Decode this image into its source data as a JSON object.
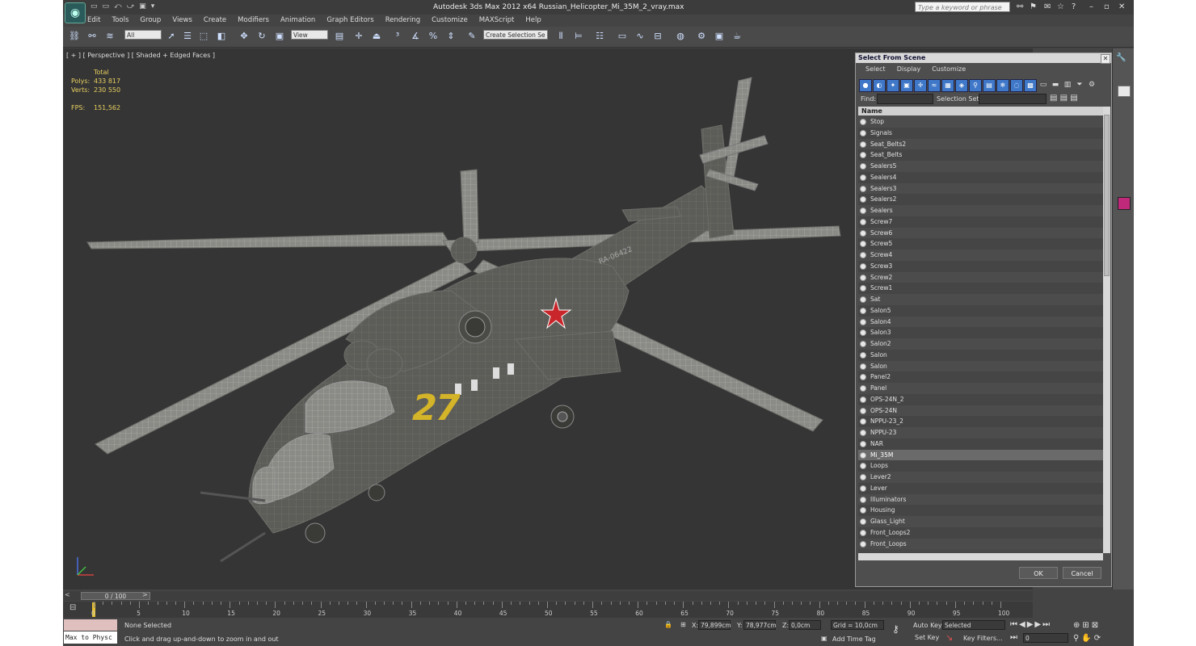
{
  "app": {
    "title": "Autodesk 3ds Max  2012 x64     Russian_Helicopter_Mi_35M_2_vray.max",
    "search_placeholder": "Type a keyword or phrase"
  },
  "menu": [
    "Edit",
    "Tools",
    "Group",
    "Views",
    "Create",
    "Modifiers",
    "Animation",
    "Graph Editors",
    "Rendering",
    "Customize",
    "MAXScript",
    "Help"
  ],
  "toolbar": {
    "selection_filter": "All",
    "reference_coord": "View",
    "named_selection": "Create Selection Se"
  },
  "viewport": {
    "label": "[ + ] [ Perspective ] [ Shaded + Edged Faces ]",
    "stats_header": "Total",
    "stats": [
      {
        "label": "Polys:",
        "value": "433 817"
      },
      {
        "label": "Verts:",
        "value": "230 550"
      }
    ],
    "fps_label": "FPS:",
    "fps_value": "151,562"
  },
  "dialog": {
    "title": "Select From Scene",
    "menu": [
      "Select",
      "Display",
      "Customize"
    ],
    "find_label": "Find:",
    "selection_set_label": "Selection Set:",
    "column_header": "Name",
    "items": [
      "Stop",
      "Signals",
      "Seat_Belts2",
      "Seat_Belts",
      "Sealers5",
      "Sealers4",
      "Sealers3",
      "Sealers2",
      "Sealers",
      "Screw7",
      "Screw6",
      "Screw5",
      "Screw4",
      "Screw3",
      "Screw2",
      "Screw1",
      "Sat",
      "Salon5",
      "Salon4",
      "Salon3",
      "Salon2",
      "Salon",
      "Salon",
      "Panel2",
      "Panel",
      "OPS-24N_2",
      "OPS-24N",
      "NPPU-23_2",
      "NPPU-23",
      "NAR",
      "Mi_35M",
      "Loops",
      "Lever2",
      "Lever",
      "Illuminators",
      "Housing",
      "Glass_Light",
      "Front_Loops2",
      "Front_Loops"
    ],
    "selected_item": "Mi_35M",
    "ok_label": "OK",
    "cancel_label": "Cancel"
  },
  "timeline": {
    "frame_label": "0 / 100",
    "ticks": [
      "0",
      "5",
      "10",
      "15",
      "20",
      "25",
      "30",
      "35",
      "40",
      "45",
      "50",
      "55",
      "60",
      "65",
      "70",
      "75",
      "80",
      "85",
      "90",
      "95",
      "100"
    ]
  },
  "status": {
    "maxscript_text": "Max to Physc",
    "selection_text": "None Selected",
    "prompt_text": "Click and drag up-and-down to zoom in and out",
    "x_label": "X:",
    "x_value": "79,899cm",
    "y_label": "Y:",
    "y_value": "78,977cm",
    "z_label": "Z:",
    "z_value": "0,0cm",
    "grid_text": "Grid = 10,0cm",
    "add_time_tag": "Add Time Tag",
    "auto_key": "Auto Key",
    "set_key": "Set Key",
    "key_mode_value": "Selected",
    "key_filters": "Key Filters...",
    "frame_value": "0"
  },
  "model": {
    "fuselage_number": "27",
    "tail_text": "RA-06422"
  },
  "colors": {
    "viewport_bg": "#353535",
    "stats_text": "#e8d060",
    "star": "#c8262a",
    "number_yellow": "#d4b428"
  }
}
